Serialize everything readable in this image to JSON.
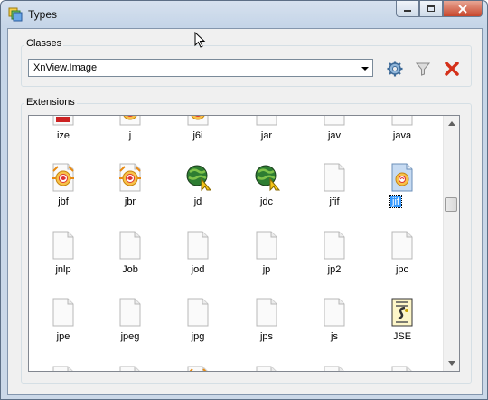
{
  "window": {
    "title": "Types"
  },
  "classes": {
    "label": "Classes",
    "selected": "XnView.Image"
  },
  "extensions": {
    "label": "Extensions",
    "rows": [
      [
        {
          "label": "ize",
          "icon": "red-file-icon"
        },
        {
          "label": "j",
          "icon": "xnview-file-icon"
        },
        {
          "label": "j6i",
          "icon": "xnview-file-icon"
        },
        {
          "label": "jar",
          "icon": "blank-file-icon"
        },
        {
          "label": "jav",
          "icon": "blank-file-icon"
        },
        {
          "label": "java",
          "icon": "blank-file-icon"
        }
      ],
      [
        {
          "label": "jbf",
          "icon": "xnview-file-icon"
        },
        {
          "label": "jbr",
          "icon": "xnview-file-icon"
        },
        {
          "label": "jd",
          "icon": "globe-file-icon"
        },
        {
          "label": "jdc",
          "icon": "globe-file-icon"
        },
        {
          "label": "jfif",
          "icon": "blank-file-icon"
        },
        {
          "label": "jif",
          "icon": "image-file-icon",
          "selected": true
        }
      ],
      [
        {
          "label": "jnlp",
          "icon": "blank-file-icon"
        },
        {
          "label": "Job",
          "icon": "blank-file-icon"
        },
        {
          "label": "jod",
          "icon": "blank-file-icon"
        },
        {
          "label": "jp",
          "icon": "blank-file-icon"
        },
        {
          "label": "jp2",
          "icon": "blank-file-icon"
        },
        {
          "label": "jpc",
          "icon": "blank-file-icon"
        }
      ],
      [
        {
          "label": "jpe",
          "icon": "blank-file-icon"
        },
        {
          "label": "jpeg",
          "icon": "blank-file-icon"
        },
        {
          "label": "jpg",
          "icon": "blank-file-icon"
        },
        {
          "label": "jps",
          "icon": "blank-file-icon"
        },
        {
          "label": "js",
          "icon": "blank-file-icon"
        },
        {
          "label": "JSE",
          "icon": "script-file-icon"
        }
      ],
      [
        {
          "label": "",
          "icon": "blank-file-icon"
        },
        {
          "label": "",
          "icon": "blank-file-icon"
        },
        {
          "label": "",
          "icon": "xnview-file-icon"
        },
        {
          "label": "",
          "icon": "blank-file-icon"
        },
        {
          "label": "",
          "icon": "blank-file-icon"
        },
        {
          "label": "",
          "icon": "blank-file-icon"
        }
      ]
    ]
  },
  "colors": {
    "selection": "#3399ff",
    "close_button": "#c7462c",
    "delete_icon": "#d4301a"
  }
}
